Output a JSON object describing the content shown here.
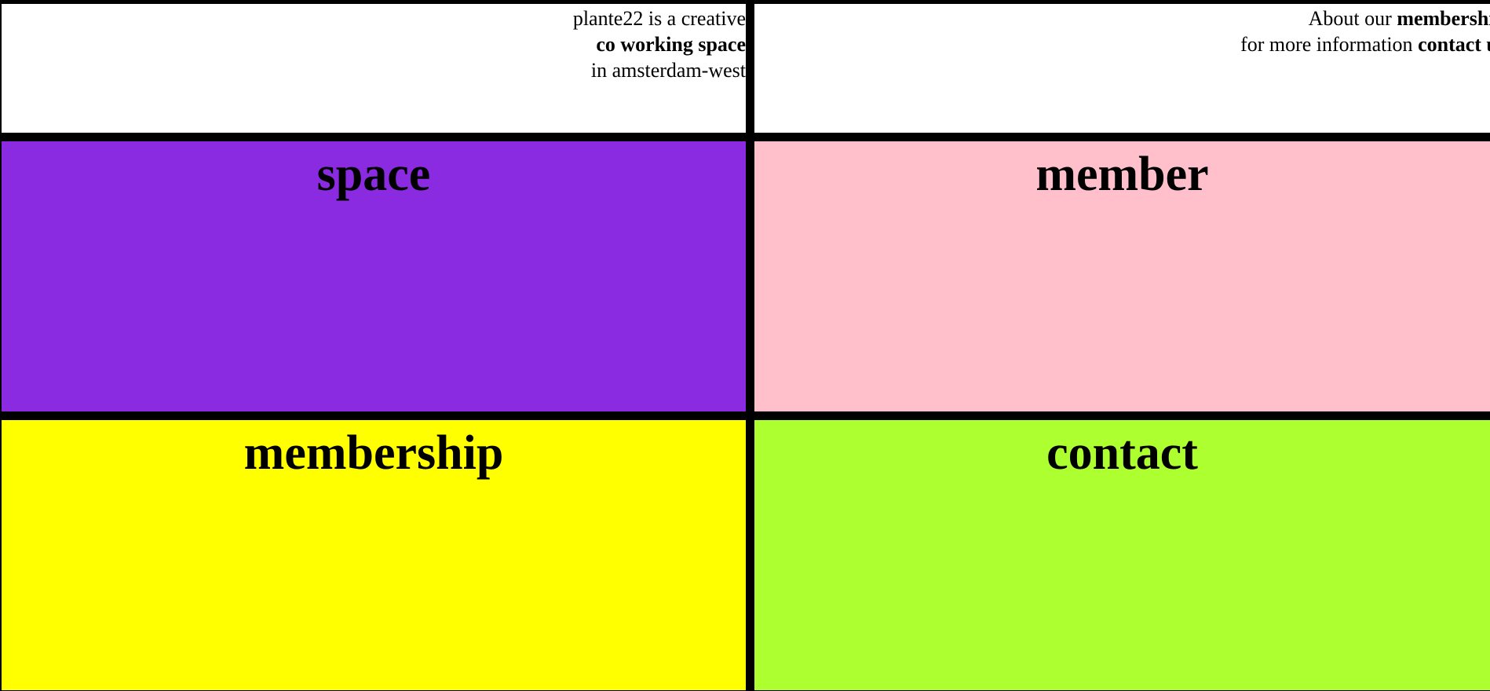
{
  "header_left": {
    "line1": "plante22 is a creative",
    "line2": "co working space",
    "line3": "in amsterdam-west"
  },
  "header_right": {
    "line1_prefix": "About our ",
    "line1_bold": "membership",
    "line2_prefix": "for more information ",
    "line2_bold": "contact us"
  },
  "tiles": [
    {
      "label": "space",
      "color": "#8A2BE2"
    },
    {
      "label": "member",
      "color": "#FFC0CB"
    },
    {
      "label": "membership",
      "color": "#FFFF00"
    },
    {
      "label": "contact",
      "color": "#ADFF2F"
    }
  ],
  "colors": {
    "background": "#000000",
    "header": "#FFFFFF",
    "text": "#000000"
  }
}
